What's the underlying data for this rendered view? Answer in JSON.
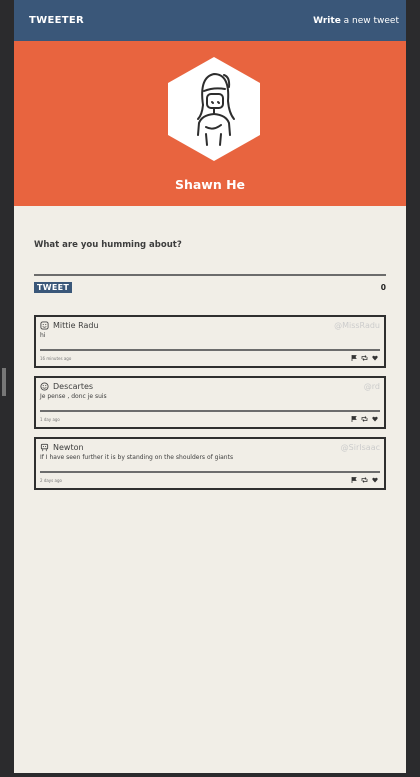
{
  "app": {
    "brand": "TWEETER"
  },
  "header": {
    "write_strong": "Write",
    "write_rest": " a new tweet"
  },
  "profile": {
    "name": "Shawn He",
    "avatar_icon": "person-sketch-icon",
    "accent": "#e8643f"
  },
  "composer": {
    "prompt": "What are you humming about?",
    "button_label": "TWEET",
    "char_count": "0"
  },
  "colors": {
    "nav": "#3a5779",
    "hero": "#e8643f",
    "background": "#f1eee7"
  },
  "tweets": [
    {
      "name": "Mittie Radu",
      "handle": "@MissRadu",
      "text": "hi",
      "time": "16 minutes ago",
      "avatar_icon": "smiley-icon"
    },
    {
      "name": "Descartes",
      "handle": "@rd",
      "text": "Je pense , donc je suis",
      "time": "1 day ago",
      "avatar_icon": "smiley-icon"
    },
    {
      "name": "Newton",
      "handle": "@SirIsaac",
      "text": "If I have seen further it is by standing on the shoulders of giants",
      "time": "2 days ago",
      "avatar_icon": "robot-icon"
    }
  ],
  "actions": [
    "flag-icon",
    "retweet-icon",
    "heart-icon"
  ]
}
